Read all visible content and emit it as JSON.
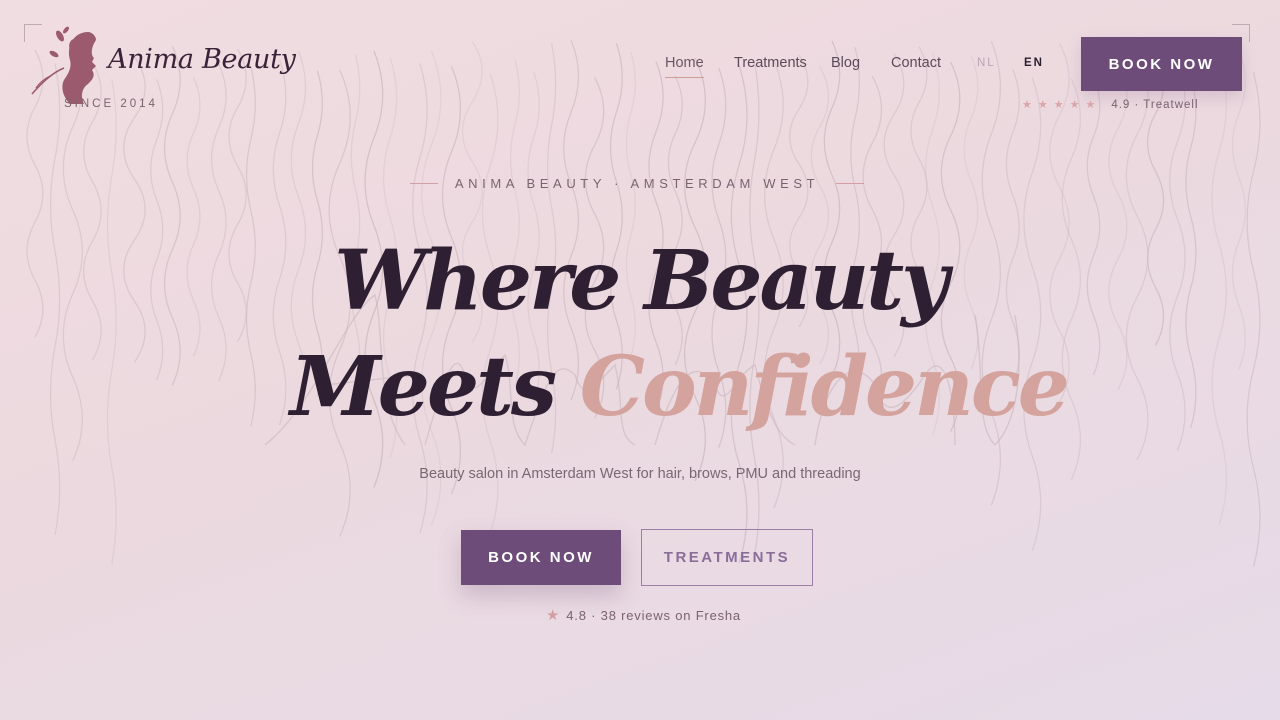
{
  "brand": {
    "name": "Anima Beauty",
    "since": "SINCE 2014",
    "logo_icon": "woman-profile-leaf-icon"
  },
  "nav": {
    "items": [
      {
        "label": "Home",
        "active": true
      },
      {
        "label": "Treatments",
        "active": false
      },
      {
        "label": "Blog",
        "active": false
      },
      {
        "label": "Contact",
        "active": false
      }
    ]
  },
  "languages": {
    "nl": "NL",
    "en": "EN",
    "selected": "EN"
  },
  "header_cta": {
    "label": "BOOK NOW"
  },
  "header_rating": {
    "stars_icon": "star-icon",
    "stars": 5,
    "text": "4.9 · Treatwell"
  },
  "hero": {
    "eyebrow": "ANIMA BEAUTY · AMSTERDAM WEST",
    "headline_line1": "Where Beauty",
    "headline_line2_plain": "Meets ",
    "headline_line2_accent": "Confidence",
    "subtitle": "Beauty salon in Amsterdam West for hair, brows, PMU and threading",
    "primary_cta": "BOOK NOW",
    "secondary_cta": "TREATMENTS",
    "reviews_icon": "star-icon",
    "reviews_text": "4.8 · 38 reviews on Fresha"
  },
  "colors": {
    "brand_purple": "#6e4c79",
    "accent_rose": "#d4a39e",
    "headline_dark": "#2e1f33",
    "background": "#efdde2"
  }
}
